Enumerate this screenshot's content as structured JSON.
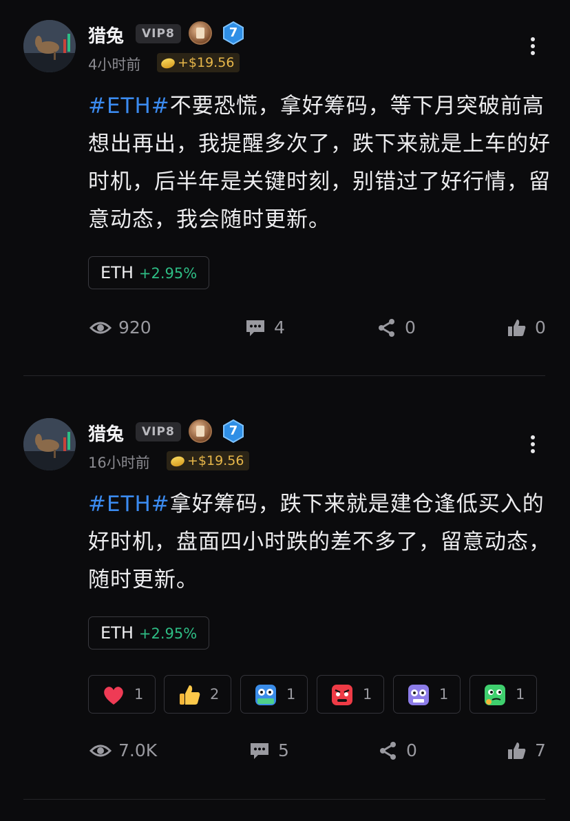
{
  "posts": [
    {
      "author": "猎兔",
      "vip": "VIP8",
      "level": "7",
      "time": "4小时前",
      "reward": "+$19.56",
      "hashtag": "#ETH#",
      "text": "不要恐慌，拿好筹码，等下月突破前高想出再出，我提醒多次了，跌下来就是上车的好时机，后半年是关键时刻，别错过了好行情，留意动态，我会随时更新。",
      "ticker": {
        "symbol": "ETH",
        "change": "+2.95%"
      },
      "stats": {
        "views": "920",
        "comments": "4",
        "shares": "0",
        "likes": "0"
      }
    },
    {
      "author": "猎兔",
      "vip": "VIP8",
      "level": "7",
      "time": "16小时前",
      "reward": "+$19.56",
      "hashtag": "#ETH#",
      "text": "拿好筹码，跌下来就是建仓逢低买入的好时机，盘面四小时跌的差不多了，留意动态，随时更新。",
      "ticker": {
        "symbol": "ETH",
        "change": "+2.95%"
      },
      "reactions": [
        {
          "icon": "heart-icon",
          "count": "1"
        },
        {
          "icon": "thumbs-up-icon",
          "count": "2"
        },
        {
          "icon": "hodl-icon",
          "count": "1"
        },
        {
          "icon": "angry-face-icon",
          "count": "1"
        },
        {
          "icon": "skull-face-icon",
          "count": "1"
        },
        {
          "icon": "thinking-face-icon",
          "count": "1"
        }
      ],
      "stats": {
        "views": "7.0K",
        "comments": "5",
        "shares": "0",
        "likes": "7"
      }
    }
  ],
  "colors": {
    "background": "#0b0b0d",
    "hashtag": "#3b8bf0",
    "positive": "#2ebd85",
    "reward": "#e9b84a"
  }
}
